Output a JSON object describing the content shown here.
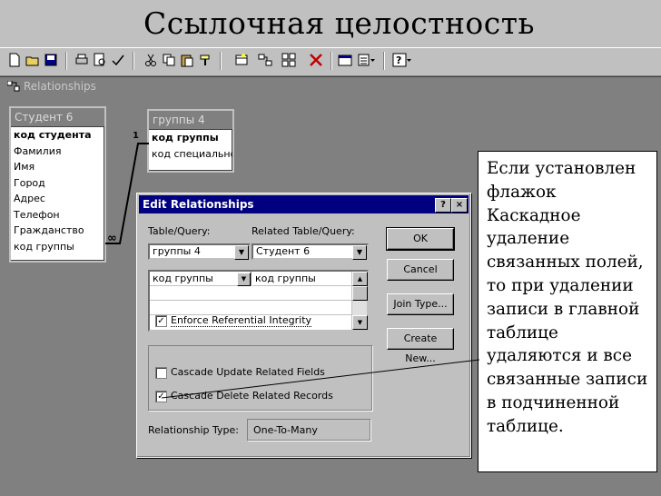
{
  "slide": {
    "title": "Ссылочная целостность"
  },
  "window": {
    "title": "Relationships"
  },
  "tables": [
    {
      "name": "Студент 6",
      "fields": [
        "код студента",
        "Фамилия",
        "Имя",
        "Город",
        "Адрес",
        "Телефон",
        "Гражданство",
        "код группы"
      ]
    },
    {
      "name": "группы 4",
      "fields": [
        "код группы",
        "код специальнос"
      ]
    }
  ],
  "relationship": {
    "one_label": "1",
    "many_label": "∞"
  },
  "dialog": {
    "title": "Edit Relationships",
    "help": "?",
    "close": "×",
    "table_query_label": "Table/Query:",
    "related_label": "Related Table/Query:",
    "table_value": "группы 4",
    "related_value": "Студент 6",
    "grid_left": "код группы",
    "grid_right": "код группы",
    "ok": "OK",
    "cancel": "Cancel",
    "join_type": "Join Type...",
    "create_new": "Create New...",
    "enforce": "Enforce Referential Integrity",
    "cascade_update": "Cascade Update Related Fields",
    "cascade_delete": "Cascade Delete Related Records",
    "enforce_checked": true,
    "cascade_update_checked": false,
    "cascade_delete_checked": true,
    "rel_type_label": "Relationship Type:",
    "rel_type_value": "One-To-Many"
  },
  "callout": {
    "lines": [
      "Если установлен",
      "флажок",
      "Каскадное",
      "удаление",
      "связанных полей,",
      "то при удалении",
      "записи в главной",
      "таблице",
      "удаляются и все",
      "связанные записи",
      "в подчиненной",
      "таблице."
    ]
  },
  "toolbar_icons": [
    "new-icon",
    "open-icon",
    "save-icon",
    "print-icon",
    "preview-icon",
    "spelling-icon",
    "cut-icon",
    "copy-icon",
    "paste-icon",
    "format-painter-icon",
    "show-table-icon",
    "show-direct-icon",
    "show-all-icon",
    "delete-icon",
    "properties-icon",
    "new-object-icon",
    "help-icon"
  ]
}
